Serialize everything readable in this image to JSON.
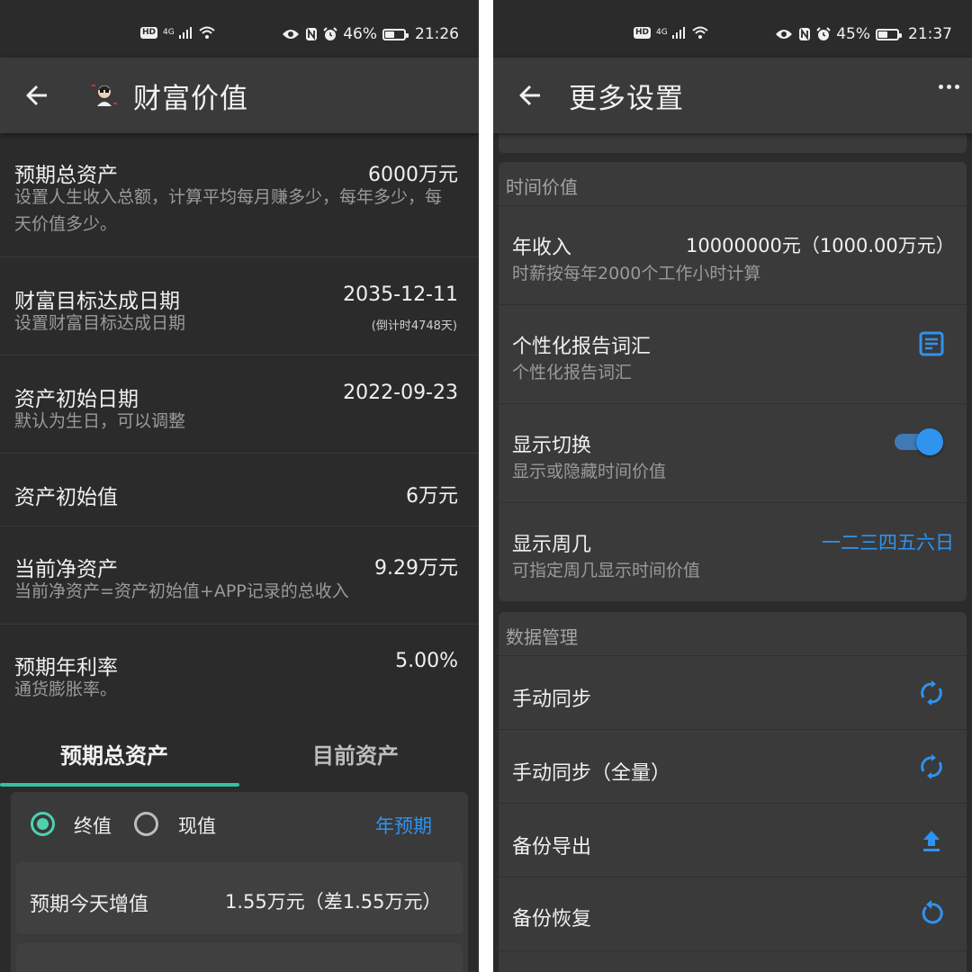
{
  "left": {
    "status": {
      "battery": "46%",
      "time": "21:26",
      "hd": "HD",
      "network": "4G",
      "battery_level": 0.46
    },
    "appbar": {
      "title": "财富价值"
    },
    "rows": [
      {
        "title": "预期总资产",
        "value": "6000万元",
        "sub": "设置人生收入总额，计算平均每月赚多少，每年多少，每天价值多少。"
      },
      {
        "title": "财富目标达成日期",
        "value": "2035-12-11",
        "value_sub": "(倒计时4748天)",
        "sub": "设置财富目标达成日期"
      },
      {
        "title": "资产初始日期",
        "value": "2022-09-23",
        "sub": "默认为生日，可以调整"
      },
      {
        "title": "资产初始值",
        "value": "6万元",
        "sub": ""
      },
      {
        "title": "当前净资产",
        "value": "9.29万元",
        "sub": "当前净资产=资产初始值+APP记录的总收入"
      },
      {
        "title": "预期年利率",
        "value": "5.00%",
        "sub": "通货膨胀率。"
      }
    ],
    "tabs": [
      "预期总资产",
      "目前资产"
    ],
    "radio": {
      "option1": "终值",
      "option2": "现值",
      "link": "年预期"
    },
    "increase": {
      "label": "预期今天增值",
      "value": "1.55万元（差1.55万元）"
    }
  },
  "right": {
    "status": {
      "battery": "45%",
      "time": "21:37",
      "hd": "HD",
      "network": "4G",
      "battery_level": 0.45
    },
    "appbar": {
      "title": "更多设置"
    },
    "section_time": {
      "header": "时间价值",
      "income": {
        "title": "年收入",
        "value": "10000000元（1000.00万元）",
        "sub": "时薪按每年2000个工作小时计算"
      },
      "vocab": {
        "title": "个性化报告词汇",
        "sub": "个性化报告词汇"
      },
      "toggle": {
        "title": "显示切换",
        "sub": "显示或隐藏时间价值",
        "on": true
      },
      "weekday": {
        "title": "显示周几",
        "value": "一二三四五六日",
        "sub": "可指定周几显示时间价值"
      }
    },
    "section_data": {
      "header": "数据管理",
      "items": [
        {
          "title": "手动同步",
          "icon": "sync-icon"
        },
        {
          "title": "手动同步（全量）",
          "icon": "sync-icon"
        },
        {
          "title": "备份导出",
          "icon": "upload-icon"
        },
        {
          "title": "备份恢复",
          "icon": "restore-icon"
        }
      ]
    }
  },
  "colors": {
    "accent_teal": "#4fd1b0",
    "accent_blue": "#2f93f0",
    "bg": "#2b2b2b",
    "card": "#3a3a3a"
  }
}
